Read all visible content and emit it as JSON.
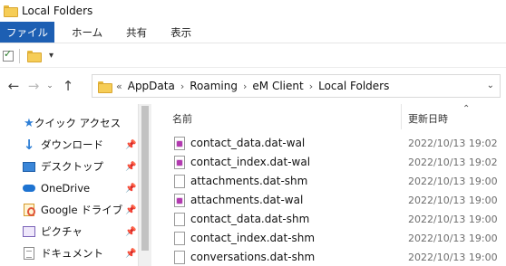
{
  "window": {
    "title": "Local Folders"
  },
  "ribbon": {
    "tabs": [
      "ファイル",
      "ホーム",
      "共有",
      "表示"
    ]
  },
  "quick_access_toolbar": {
    "dropdown_glyph": "▾"
  },
  "address_bar": {
    "overflow": "«",
    "crumbs": [
      "AppData",
      "Roaming",
      "eM Client",
      "Local Folders"
    ]
  },
  "navigation_pane": {
    "items": [
      {
        "label": "クイック アクセス",
        "icon": "star-icon",
        "pinned": false
      },
      {
        "label": "ダウンロード",
        "icon": "download-icon",
        "pinned": true
      },
      {
        "label": "デスクトップ",
        "icon": "desktop-icon",
        "pinned": true
      },
      {
        "label": "OneDrive",
        "icon": "onedrive-icon",
        "pinned": true
      },
      {
        "label": "Google ドライブ",
        "icon": "google-drive-icon",
        "pinned": true
      },
      {
        "label": "ピクチャ",
        "icon": "pictures-icon",
        "pinned": true
      },
      {
        "label": "ドキュメント",
        "icon": "documents-icon",
        "pinned": true
      }
    ]
  },
  "file_list": {
    "columns": {
      "name": "名前",
      "modified": "更新日時"
    },
    "rows": [
      {
        "name": "contact_data.dat-wal",
        "modified": "2022/10/13 19:02",
        "icon": "wal-file-icon"
      },
      {
        "name": "contact_index.dat-wal",
        "modified": "2022/10/13 19:02",
        "icon": "wal-file-icon"
      },
      {
        "name": "attachments.dat-shm",
        "modified": "2022/10/13 19:00",
        "icon": "file-icon"
      },
      {
        "name": "attachments.dat-wal",
        "modified": "2022/10/13 19:00",
        "icon": "wal-file-icon"
      },
      {
        "name": "contact_data.dat-shm",
        "modified": "2022/10/13 19:00",
        "icon": "file-icon"
      },
      {
        "name": "contact_index.dat-shm",
        "modified": "2022/10/13 19:00",
        "icon": "file-icon"
      },
      {
        "name": "conversations.dat-shm",
        "modified": "2022/10/13 19:00",
        "icon": "file-icon"
      }
    ]
  },
  "colors": {
    "file_tab": "#1d5fb3",
    "folder": "#f6cd57",
    "accent": "#2f7fd6"
  }
}
